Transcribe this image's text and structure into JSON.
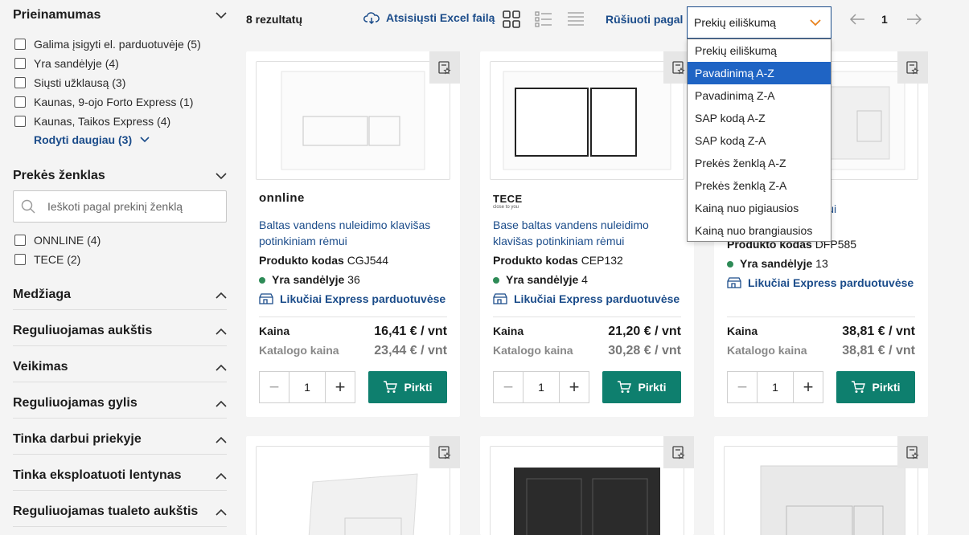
{
  "sidebar": {
    "availability": {
      "title": "Prieinamumas",
      "options": [
        "Galima įsigyti el. parduotuvėje (5)",
        "Yra sandėlyje (4)",
        "Siųsti užklausą (3)",
        "Kaunas, 9-ojo Forto Express (1)",
        "Kaunas, Taikos Express (4)"
      ],
      "show_more": "Rodyti daugiau (3)"
    },
    "brand": {
      "title": "Prekės ženklas",
      "search_placeholder": "Ieškoti pagal prekinį ženklą",
      "options": [
        "ONNLINE (4)",
        "TECE (2)"
      ]
    },
    "collapsed_sections": [
      "Medžiaga",
      "Reguliuojamas aukštis",
      "Veikimas",
      "Reguliuojamas gylis",
      "Tinka darbui priekyje",
      "Tinka eksploatuoti lentynas",
      "Reguliuojamas tualeto aukštis"
    ]
  },
  "toolbar": {
    "results": "8 rezultatų",
    "excel": "Atsisiųsti Excel failą",
    "sort_label": "Rūšiuoti pagal",
    "sort_selected": "Prekių eiliškumą",
    "page": "1"
  },
  "sort_options": [
    "Prekių eiliškumą",
    "Pavadinimą A-Z",
    "Pavadinimą Z-A",
    "SAP kodą A-Z",
    "SAP kodą Z-A",
    "Prekės ženklą A-Z",
    "Prekės ženklą Z-A",
    "Kainą nuo pigiausios",
    "Kainą nuo brangiausios"
  ],
  "sort_highlighted": "Pavadinimą A-Z",
  "labels": {
    "code": "Produkto kodas",
    "stock": "Yra sandėlyje",
    "express": "Likučiai Express parduotuvėse",
    "price": "Kaina",
    "catalog_price": "Katalogo kaina",
    "buy": "Pirkti",
    "qty": "1"
  },
  "products": [
    {
      "brand": "onnline",
      "title": "Baltas vandens nuleidimo klavišas potinkiniam rėmui",
      "code": "CGJ544",
      "stock": "36",
      "price": "16,41 € / vnt",
      "catalog_price": "23,44 € / vnt"
    },
    {
      "brand": "TECE",
      "brand_sub": "close to you",
      "title": "Base baltas vandens nuleidimo klavišas potinkiniam rėmui",
      "code": "CEP132",
      "stock": "4",
      "price": "21,20 € / vnt",
      "catalog_price": "30,28 € / vnt"
    },
    {
      "brand": "",
      "title": "...leidimo klavišas ...ui",
      "code": "DFP585",
      "stock": "13",
      "price": "38,81 € / vnt",
      "catalog_price": "38,81 € / vnt"
    }
  ],
  "colors": {
    "link": "#1b4c8a",
    "buy": "#0e7f6e",
    "stock_dot": "#2e8b57",
    "dropdown_highlight": "#1f64c4"
  }
}
